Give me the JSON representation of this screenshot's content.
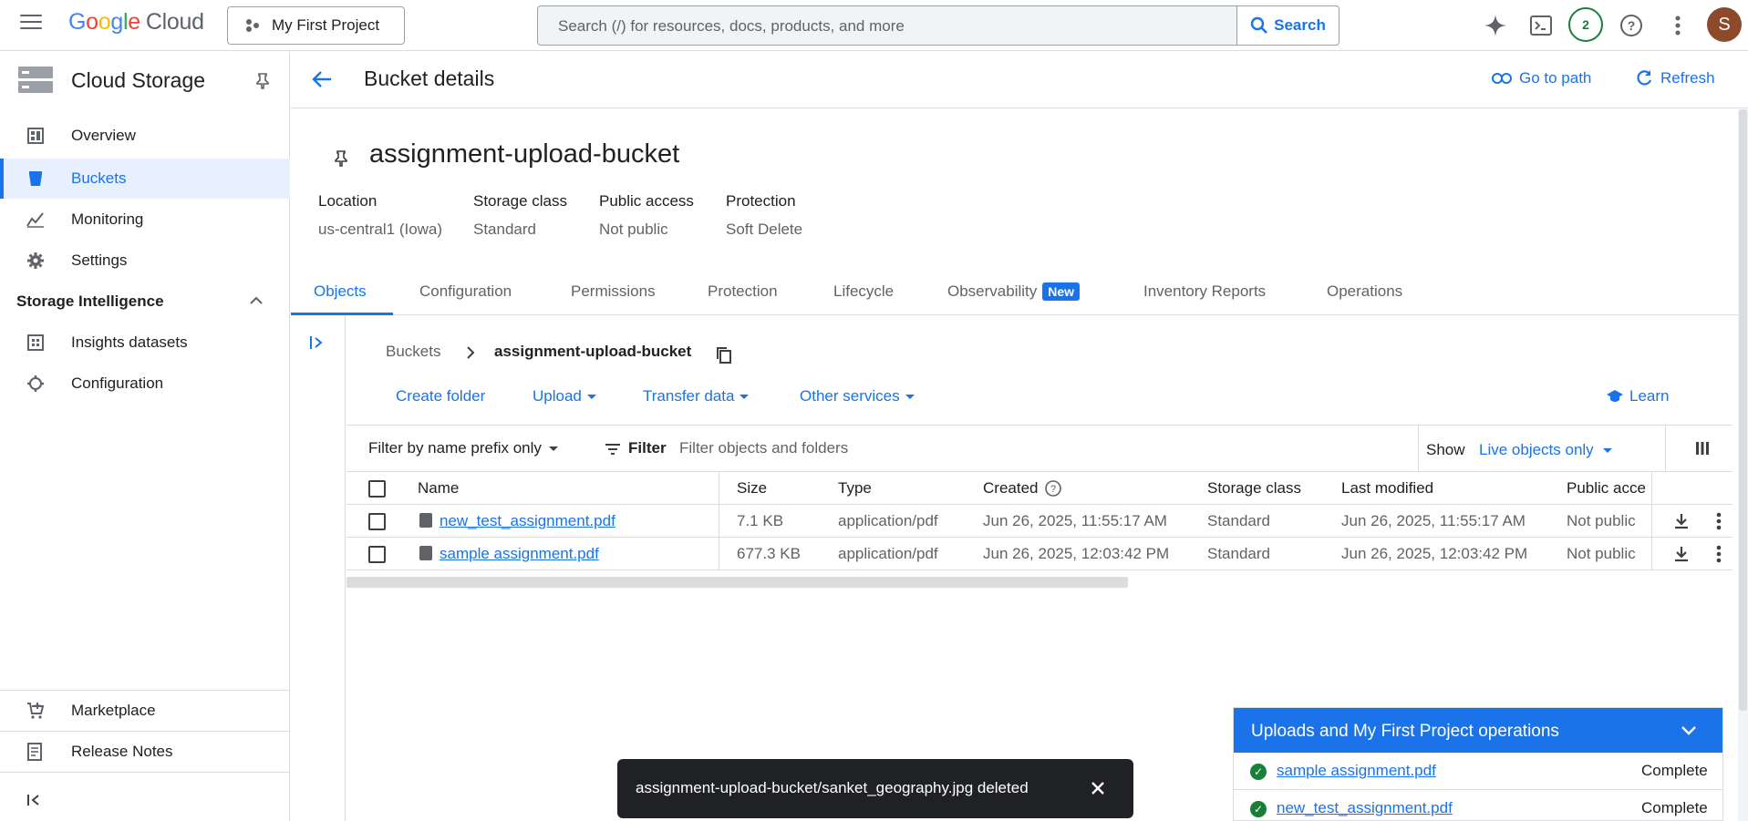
{
  "topbar": {
    "logo_google": "Google",
    "logo_cloud": "Cloud",
    "project": "My First Project",
    "search_placeholder": "Search (/) for resources, docs, products, and more",
    "search_button": "Search",
    "notifications_count": "2",
    "avatar_letter": "S"
  },
  "sidebar": {
    "title": "Cloud Storage",
    "items": [
      {
        "label": "Overview",
        "icon": "overview-icon"
      },
      {
        "label": "Buckets",
        "icon": "bucket-icon"
      },
      {
        "label": "Monitoring",
        "icon": "monitoring-icon"
      },
      {
        "label": "Settings",
        "icon": "gear-icon"
      }
    ],
    "section": "Storage Intelligence",
    "section_items": [
      {
        "label": "Insights datasets",
        "icon": "dataset-icon"
      },
      {
        "label": "Configuration",
        "icon": "settings-outline-icon"
      }
    ],
    "bottom_items": [
      {
        "label": "Marketplace",
        "icon": "cart-icon"
      },
      {
        "label": "Release Notes",
        "icon": "notes-icon"
      }
    ]
  },
  "header": {
    "title": "Bucket details",
    "go_to_path": "Go to path",
    "refresh": "Refresh"
  },
  "bucket": {
    "name": "assignment-upload-bucket",
    "meta": [
      {
        "label": "Location",
        "value": "us-central1 (Iowa)"
      },
      {
        "label": "Storage class",
        "value": "Standard"
      },
      {
        "label": "Public access",
        "value": "Not public"
      },
      {
        "label": "Protection",
        "value": "Soft Delete"
      }
    ]
  },
  "tabs": [
    "Objects",
    "Configuration",
    "Permissions",
    "Protection",
    "Lifecycle",
    "Observability",
    "Inventory Reports",
    "Operations"
  ],
  "new_badge": "New",
  "breadcrumb": {
    "root": "Buckets",
    "current": "assignment-upload-bucket"
  },
  "actions": {
    "create_folder": "Create folder",
    "upload": "Upload",
    "transfer": "Transfer data",
    "other": "Other services",
    "learn": "Learn"
  },
  "filter": {
    "mode": "Filter by name prefix only",
    "label": "Filter",
    "placeholder": "Filter objects and folders",
    "show_label": "Show",
    "show_value": "Live objects only"
  },
  "table": {
    "columns": [
      "Name",
      "Size",
      "Type",
      "Created",
      "Storage class",
      "Last modified",
      "Public acce"
    ],
    "rows": [
      {
        "name": "new_test_assignment.pdf",
        "size": "7.1 KB",
        "type": "application/pdf",
        "created": "Jun 26, 2025, 11:55:17 AM",
        "class": "Standard",
        "modified": "Jun 26, 2025, 11:55:17 AM",
        "public": "Not public"
      },
      {
        "name": "sample assignment.pdf",
        "size": "677.3 KB",
        "type": "application/pdf",
        "created": "Jun 26, 2025, 12:03:42 PM",
        "class": "Standard",
        "modified": "Jun 26, 2025, 12:03:42 PM",
        "public": "Not public"
      }
    ]
  },
  "toast": {
    "message": "assignment-upload-bucket/sanket_geography.jpg deleted"
  },
  "uploads": {
    "title": "Uploads and My First Project operations",
    "items": [
      {
        "name": "sample assignment.pdf",
        "status": "Complete"
      },
      {
        "name": "new_test_assignment.pdf",
        "status": "Complete"
      }
    ]
  },
  "colors": {
    "accent": "#1a73e8",
    "success": "#188038",
    "toast_bg": "#202124"
  }
}
